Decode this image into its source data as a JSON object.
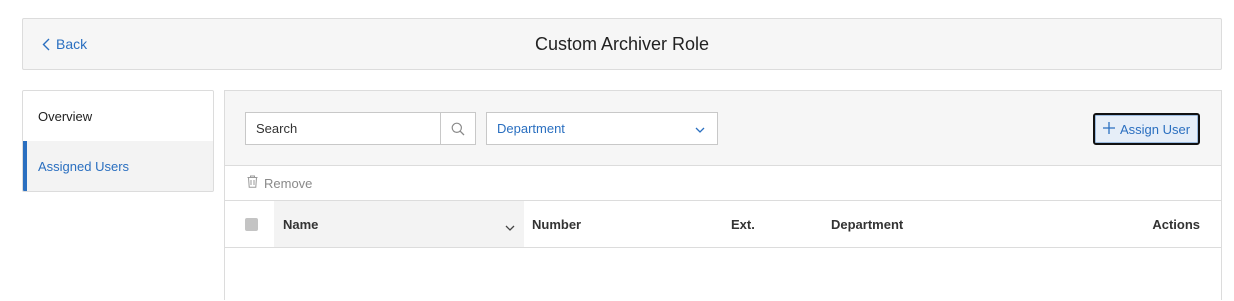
{
  "header": {
    "back_label": "Back",
    "title": "Custom Archiver Role"
  },
  "sidebar": {
    "items": [
      {
        "label": "Overview",
        "active": false
      },
      {
        "label": "Assigned Users",
        "active": true
      }
    ]
  },
  "toolbar": {
    "search_placeholder": "Search",
    "department_select": "Department",
    "assign_label": "Assign User"
  },
  "actions": {
    "remove_label": "Remove"
  },
  "table": {
    "columns": [
      "Name",
      "Number",
      "Ext.",
      "Department",
      "Actions"
    ],
    "rows": []
  },
  "colors": {
    "accent": "#2a6fc0",
    "panel_bg": "#f6f6f6",
    "border": "#dcdcdc"
  }
}
